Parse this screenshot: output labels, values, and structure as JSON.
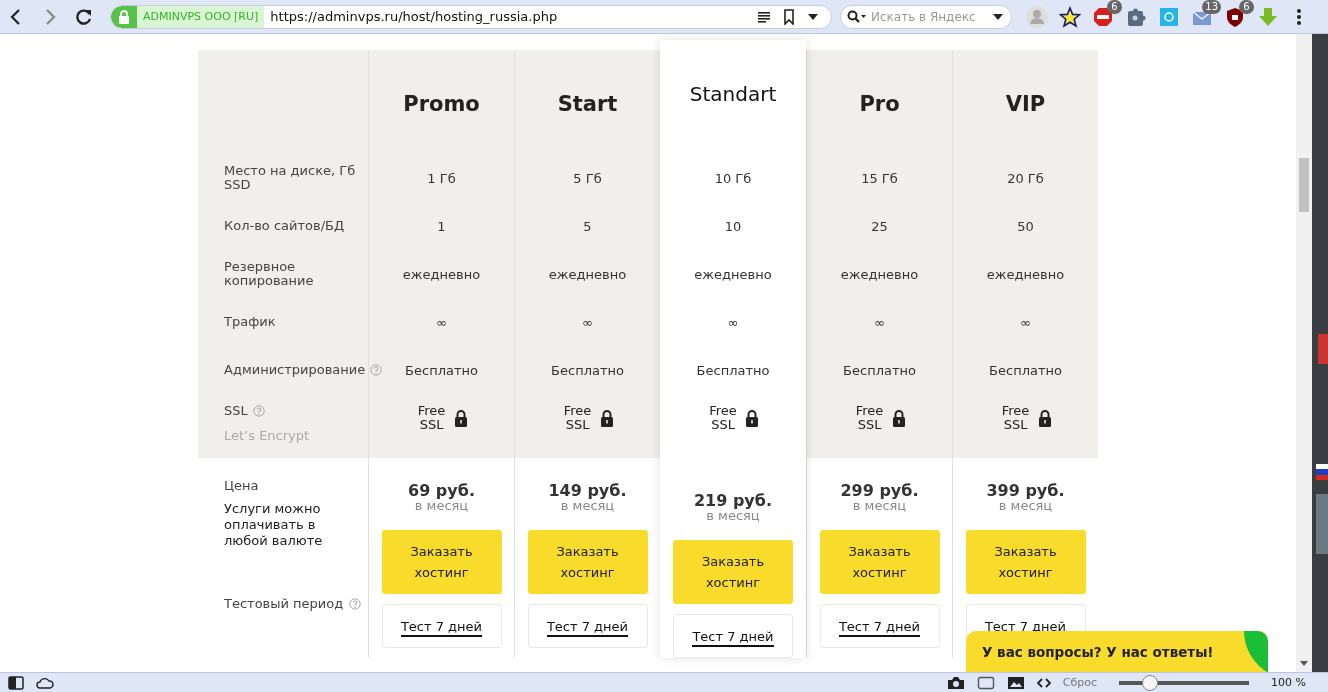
{
  "browser": {
    "nav_buttons": [
      {
        "kind": "back",
        "disabled": false
      },
      {
        "kind": "forward",
        "disabled": true
      },
      {
        "kind": "reload",
        "disabled": false
      }
    ],
    "site_identity": "ADMINVPS OOO [RU]",
    "url": "https://adminvps.ru/host/hosting_russia.php",
    "search": {
      "placeholder": "Искать в Яндекс"
    },
    "extensions": [
      {
        "kind": "avatar"
      },
      {
        "kind": "star"
      },
      {
        "kind": "abp",
        "badge": "6"
      },
      {
        "kind": "puzzle"
      },
      {
        "kind": "tile"
      },
      {
        "kind": "mail",
        "badge": "13"
      },
      {
        "kind": "shield",
        "badge": "6"
      },
      {
        "kind": "download"
      }
    ]
  },
  "table": {
    "row_labels": [
      {
        "label": "Место на диске, Гб SSD",
        "help": false
      },
      {
        "label": "Кол-во сайтов/БД",
        "help": false
      },
      {
        "label": "Резервное копирование",
        "help": false
      },
      {
        "label": "Трафик",
        "help": false
      },
      {
        "label": "Администрирование",
        "help": true
      },
      {
        "label": "SSL",
        "help": true,
        "note": "Let’s Encrypt"
      }
    ],
    "price_label": "Цена",
    "price_note": "Услуги можно оплачивать в любой валюте",
    "test_label": "Тестовый период",
    "test_help": true,
    "plans": [
      {
        "name": "Promo",
        "selected": false,
        "values": [
          "1 Гб",
          "1",
          "ежедневно",
          "∞",
          "Бесплатно",
          "Free SSL"
        ],
        "price": "69 руб.",
        "period": "в месяц",
        "order": "Заказать хостинг",
        "test": "Тест 7 дней"
      },
      {
        "name": "Start",
        "selected": false,
        "values": [
          "5 Гб",
          "5",
          "ежедневно",
          "∞",
          "Бесплатно",
          "Free SSL"
        ],
        "price": "149 руб.",
        "period": "в месяц",
        "order": "Заказать хостинг",
        "test": "Тест 7 дней"
      },
      {
        "name": "Standart",
        "selected": true,
        "values": [
          "10 Гб",
          "10",
          "ежедневно",
          "∞",
          "Бесплатно",
          "Free SSL"
        ],
        "price": "219 руб.",
        "period": "в месяц",
        "order": "Заказать хостинг",
        "test": "Тест 7 дней"
      },
      {
        "name": "Pro",
        "selected": false,
        "values": [
          "15 Гб",
          "25",
          "ежедневно",
          "∞",
          "Бесплатно",
          "Free SSL"
        ],
        "price": "299 руб.",
        "period": "в месяц",
        "order": "Заказать хостинг",
        "test": "Тест 7 дней"
      },
      {
        "name": "VIP",
        "selected": false,
        "values": [
          "20 Гб",
          "50",
          "ежедневно",
          "∞",
          "Бесплатно",
          "Free SSL"
        ],
        "price": "399 руб.",
        "period": "в месяц",
        "order": "Заказать хостинг",
        "test": "Тест 7 дней"
      }
    ]
  },
  "chat": {
    "text": "У вас вопросы? У нас ответы!"
  },
  "status_bar": {
    "reset": "Сброс",
    "zoom": {
      "level": 0.2
    },
    "zoom_text": "100 %"
  }
}
